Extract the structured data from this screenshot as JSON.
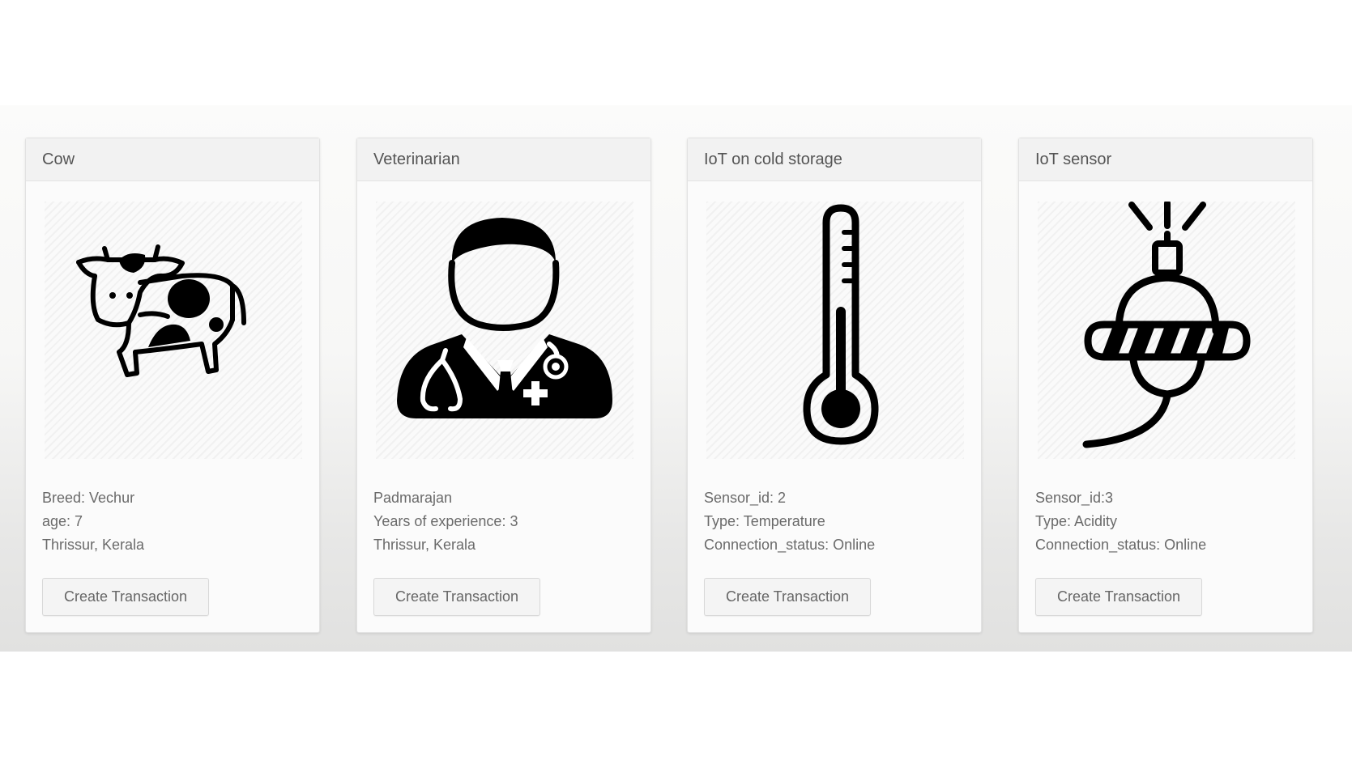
{
  "cards": [
    {
      "title": "Cow",
      "icon": "cow-icon",
      "details": [
        "Breed: Vechur",
        "age: 7",
        "Thrissur, Kerala"
      ],
      "button_label": "Create Transaction"
    },
    {
      "title": "Veterinarian",
      "icon": "doctor-icon",
      "details": [
        "Padmarajan",
        "Years of experience: 3",
        "Thrissur, Kerala"
      ],
      "button_label": "Create Transaction"
    },
    {
      "title": "IoT on cold storage",
      "icon": "thermometer-icon",
      "details": [
        "Sensor_id: 2",
        "Type: Temperature",
        "Connection_status: Online"
      ],
      "button_label": "Create Transaction"
    },
    {
      "title": "IoT sensor",
      "icon": "sensor-icon",
      "details": [
        "Sensor_id:3",
        "Type: Acidity",
        "Connection_status: Online"
      ],
      "button_label": "Create Transaction"
    }
  ],
  "colors": {
    "icon": "#000000",
    "card_header_bg": "#f2f2f2",
    "text": "#6a6a6a"
  }
}
